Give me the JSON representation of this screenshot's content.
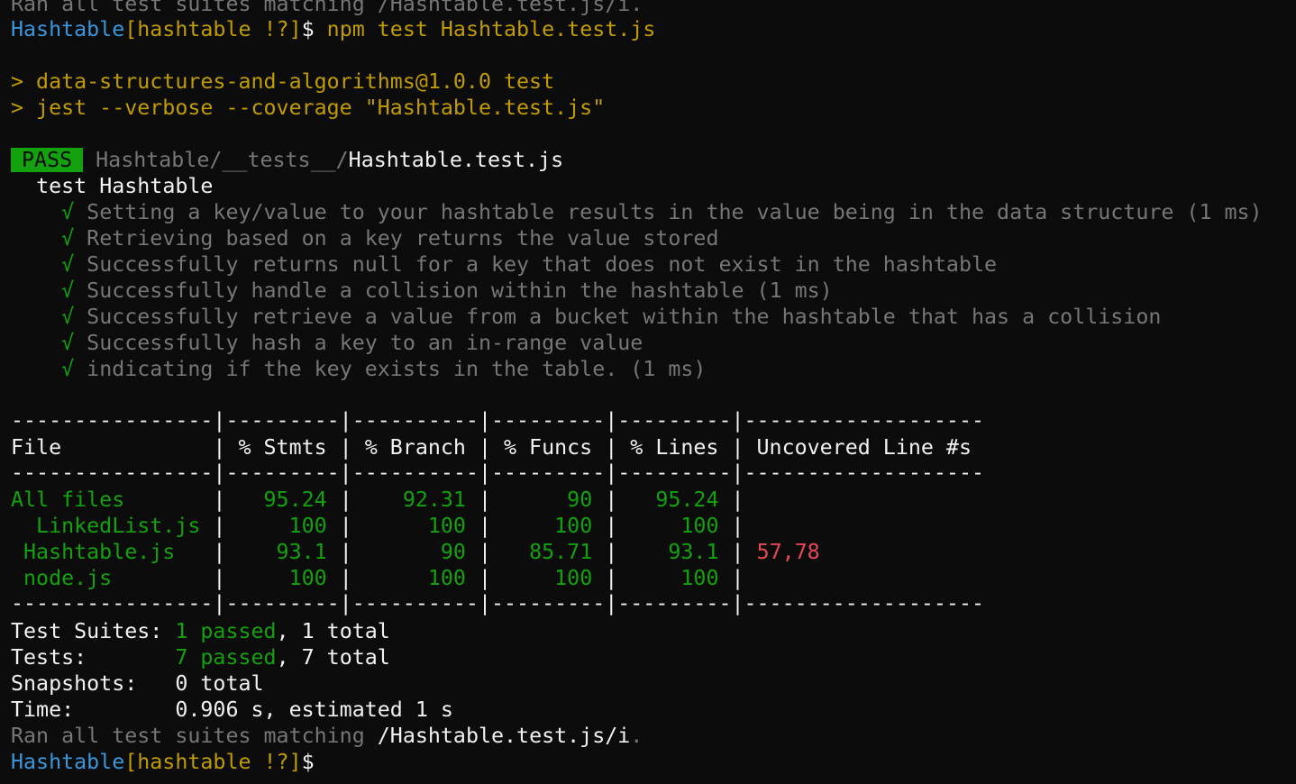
{
  "terminal": {
    "top_partial": "Ran all test suites matching /Hashtable.test.js/i.",
    "prompt": {
      "dir": "Hashtable",
      "branch": "[hashtable !?]",
      "symbol": "$",
      "command": "npm test Hashtable.test.js"
    },
    "script": {
      "line1": "> data-structures-and-algorithms@1.0.0 test",
      "line2": "> jest --verbose --coverage \"Hashtable.test.js\""
    },
    "result": {
      "badge": "PASS",
      "path_dir": "Hashtable/__tests__/",
      "path_file": "Hashtable.test.js",
      "suite": "test Hashtable",
      "check_glyph": "√",
      "tests": [
        "Setting a key/value to your hashtable results in the value being in the data structure (1 ms)",
        "Retrieving based on a key returns the value stored",
        "Successfully returns null for a key that does not exist in the hashtable",
        "Successfully handle a collision within the hashtable (1 ms)",
        "Successfully retrieve a value from a bucket within the hashtable that has a collision",
        "Successfully hash a key to an in-range value",
        "indicating if the key exists in the table. (1 ms)"
      ]
    },
    "coverage": {
      "sep": "----------------|---------|----------|---------|---------|-------------------",
      "header": "File            | % Stmts | % Branch | % Funcs | % Lines | Uncovered Line #s ",
      "rows": [
        {
          "file": "All files       ",
          "stmts": "   95.24 ",
          "branch": "    92.31 ",
          "funcs": "      90 ",
          "lines": "   95.24 ",
          "uncovered": ""
        },
        {
          "file": "  LinkedList.js ",
          "stmts": "     100 ",
          "branch": "      100 ",
          "funcs": "     100 ",
          "lines": "     100 ",
          "uncovered": ""
        },
        {
          "file": " Hashtable.js   ",
          "stmts": "    93.1 ",
          "branch": "       90 ",
          "funcs": "   85.71 ",
          "lines": "    93.1 ",
          "uncovered": "57,78"
        },
        {
          "file": " node.js        ",
          "stmts": "     100 ",
          "branch": "      100 ",
          "funcs": "     100 ",
          "lines": "     100 ",
          "uncovered": ""
        }
      ]
    },
    "summary": {
      "suites_label": "Test Suites: ",
      "suites_passed": "1 passed",
      "suites_total": ", 1 total",
      "tests_label": "Tests:       ",
      "tests_passed": "7 passed",
      "tests_total": ", 7 total",
      "snapshots_label": "Snapshots:   ",
      "snapshots_value": "0 total",
      "time_label": "Time:        ",
      "time_value": "0.906 s, estimated 1 s",
      "ran_prefix": "Ran all test suites matching ",
      "ran_pattern": "/Hashtable.test.js/i",
      "ran_suffix": "."
    },
    "colors": {
      "background": "#0c0c0c",
      "foreground": "#cccccc",
      "bright": "#f2f2f2",
      "dim": "#767676",
      "yellow": "#c19c00",
      "blue": "#3a96dd",
      "green": "#13a10e",
      "red": "#e74856"
    }
  }
}
